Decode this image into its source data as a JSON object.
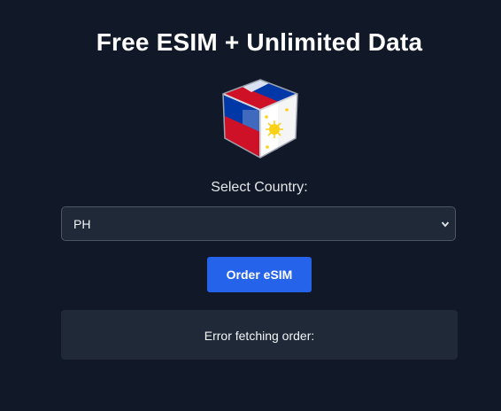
{
  "header": {
    "title": "Free ESIM + Unlimited Data"
  },
  "logo": {
    "icon": "philippines-flag-cube-icon",
    "colors": {
      "blue": "#0038a8",
      "red": "#ce1126",
      "white": "#ffffff",
      "gold": "#fcd116"
    }
  },
  "country": {
    "label": "Select Country:",
    "selected": "PH"
  },
  "actions": {
    "order_label": "Order eSIM"
  },
  "status": {
    "message": "Error fetching order:"
  },
  "theme": {
    "background": "#111827",
    "panel": "#1f2937",
    "accent": "#2563eb"
  }
}
